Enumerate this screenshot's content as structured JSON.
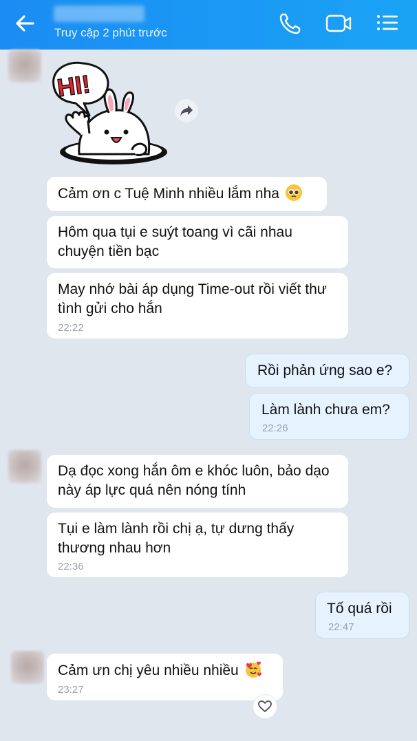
{
  "header": {
    "status": "Truy cập 2 phút trước",
    "accent_color": "#1b8cf3",
    "back_icon": "arrow-left-icon",
    "call_icon": "phone-icon",
    "video_icon": "video-camera-icon",
    "menu_icon": "list-menu-icon"
  },
  "sticker": {
    "text": "HI!"
  },
  "messages": [
    {
      "dir": "in",
      "text": "Cảm ơn c Tuệ Minh nhiều lắm nha"
    },
    {
      "dir": "in",
      "text": "Hôm qua tụi e suýt toang vì cãi nhau chuyện tiền bạc"
    },
    {
      "dir": "in",
      "text": "May nhớ bài áp dụng Time-out rồi viết thư tình gửi cho hắn",
      "time": "22:22"
    },
    {
      "dir": "out",
      "text": "Rồi phản ứng sao e?"
    },
    {
      "dir": "out",
      "text": "Làm lành chưa em?",
      "time": "22:26"
    },
    {
      "dir": "in",
      "text": "Dạ đọc xong hắn ôm e khóc luôn, bảo dạo này áp lực quá nên nóng tính"
    },
    {
      "dir": "in",
      "text": "Tụi e làm lành rồi chị ạ, tự dưng thấy thương nhau hơn",
      "time": "22:36"
    },
    {
      "dir": "out",
      "text": "Tố quá rồi",
      "time": "22:47"
    },
    {
      "dir": "in",
      "text": "Cảm ưn chị yêu nhiều nhiều",
      "time": "23:27"
    }
  ]
}
